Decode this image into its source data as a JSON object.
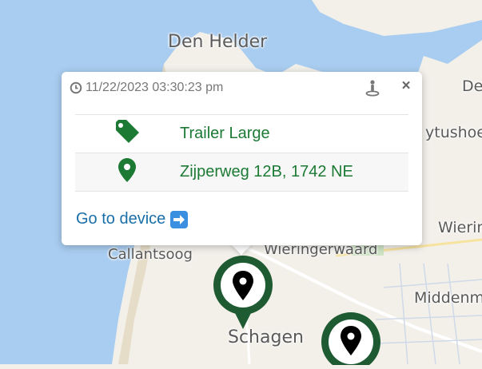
{
  "map": {
    "places": [
      "Den Helder",
      "Callantsoog",
      "Wieringerwaard",
      "Schagen",
      "Wierin",
      "Middenm",
      "ytushoe",
      "De"
    ],
    "colors": {
      "water": "#a9cdf0",
      "land": "#f3f0ea",
      "dunes": "#e6ddc8",
      "marker": "#1e5a32"
    }
  },
  "popup": {
    "timestamp": "11/22/2023 03:30:23 pm",
    "close_symbol": "×",
    "rows": [
      {
        "icon": "tag-icon",
        "value": "Trailer Large"
      },
      {
        "icon": "location-pin-icon",
        "value": "Zijperweg 12B, 1742 NE"
      }
    ],
    "goto_label": "Go to device",
    "goto_icon": "right-arrow-icon"
  },
  "colors": {
    "accent_green": "#1c7a35",
    "link_blue": "#1a6fa8"
  }
}
